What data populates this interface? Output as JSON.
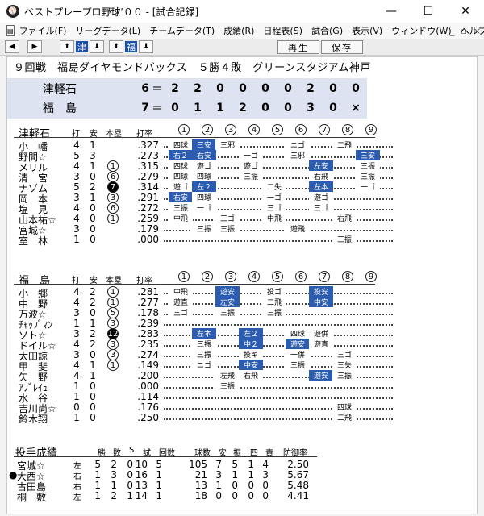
{
  "window": {
    "title": "ベストプレープロ野球'００ - [試合記録]",
    "minimize": "—",
    "maximize": "☐",
    "close": "✕"
  },
  "menu": [
    "ファイル(F)",
    "リーグデータ(L)",
    "チームデータ(T)",
    "成績(R)",
    "日程表(S)",
    "試合(G)",
    "表示(V)",
    "ウィンドウ(W)",
    "ヘルプ(H)"
  ],
  "mdi": {
    "minimize": "_",
    "restore": "▫",
    "close": "×"
  },
  "toolbar": {
    "prev": "◀",
    "next": "▶",
    "team1_up": "⬆",
    "team1_label": "津",
    "team1_down": "⬇",
    "team2_up": "⬆",
    "team2_label": "福",
    "team2_down": "⬇",
    "replay": "再生",
    "save": "保存"
  },
  "headline": "９回戦　福島ダイヤモンドバックス　５勝４敗　グリーンスタジアム神戸",
  "linescore": [
    {
      "team": "津軽石",
      "total": "6",
      "eq": "＝",
      "innings": [
        "2",
        "2",
        "0",
        "0",
        "0",
        "0",
        "2",
        "0",
        "0"
      ]
    },
    {
      "team": "福　島",
      "total": "7",
      "eq": "＝",
      "innings": [
        "0",
        "1",
        "1",
        "2",
        "0",
        "0",
        "3",
        "0",
        "×"
      ]
    }
  ],
  "innings_header": [
    "1",
    "2",
    "3",
    "4",
    "5",
    "6",
    "7",
    "8",
    "9"
  ],
  "col_labels": {
    "ab": "打",
    "h": "安",
    "hr": "本塁",
    "avg": "打率"
  },
  "away": {
    "team": "津軽石",
    "batters": [
      {
        "name": "小　幡",
        "ab": "4",
        "h": "1",
        "hr": "",
        "avg": ".327",
        "results": [
          "四球",
          "三安",
          "三邪",
          "",
          "",
          "ニゴ",
          "",
          "二飛",
          ""
        ]
      },
      {
        "name": "野間☆",
        "ab": "5",
        "h": "3",
        "hr": "",
        "avg": ".273",
        "results": [
          "右２",
          "右安",
          "",
          "一ゴ",
          "",
          "三邪",
          "",
          "",
          "三安"
        ]
      },
      {
        "name": "メリル",
        "ab": "4",
        "h": "1",
        "hr": "1",
        "avg": ".315",
        "results": [
          "四球",
          "遊ゴ",
          "",
          "遊ゴ",
          "",
          "",
          "左安",
          "",
          "三振"
        ]
      },
      {
        "name": "清　宮",
        "ab": "3",
        "h": "0",
        "hr": "6",
        "avg": ".279",
        "results": [
          "四球",
          "四球",
          "",
          "三振",
          "",
          "",
          "右飛",
          "",
          "三振"
        ]
      },
      {
        "name": "ナゾム",
        "ab": "5",
        "h": "2",
        "hr": "7",
        "avg": ".314",
        "results": [
          "遊ゴ",
          "左２",
          "",
          "",
          "二失",
          "",
          "左本",
          "",
          "一ゴ"
        ]
      },
      {
        "name": "岡　本",
        "ab": "3",
        "h": "1",
        "hr": "3",
        "avg": ".291",
        "results": [
          "右安",
          "四球",
          "",
          "",
          "一ゴ",
          "",
          "遊ゴ",
          "",
          ""
        ]
      },
      {
        "name": "塩　見",
        "ab": "4",
        "h": "0",
        "hr": "6",
        "avg": ".272",
        "results": [
          "三振",
          "一ゴ",
          "",
          "",
          "三ゴ",
          "",
          "三ゴ",
          "",
          ""
        ]
      },
      {
        "name": "山本祐☆",
        "ab": "4",
        "h": "0",
        "hr": "1",
        "avg": ".259",
        "results": [
          "中飛",
          "",
          "三ゴ",
          "",
          "中飛",
          "",
          "",
          "右飛",
          ""
        ]
      },
      {
        "name": "宮城☆",
        "ab": "3",
        "h": "0",
        "hr": "",
        "avg": ".179",
        "results": [
          "",
          "三振",
          "三振",
          "",
          "",
          "遊飛",
          "",
          "",
          ""
        ]
      },
      {
        "name": "室　林",
        "ab": "1",
        "h": "0",
        "hr": "",
        "avg": ".000",
        "results": [
          "",
          "",
          "",
          "",
          "",
          "",
          "",
          "三振",
          ""
        ]
      }
    ]
  },
  "home": {
    "team": "福　島",
    "batters": [
      {
        "name": "小　郷",
        "ab": "4",
        "h": "2",
        "hr": "1",
        "avg": ".281",
        "results": [
          "中飛",
          "",
          "遊安",
          "",
          "投ゴ",
          "",
          "投安",
          "",
          ""
        ]
      },
      {
        "name": "中　野",
        "ab": "4",
        "h": "2",
        "hr": "1",
        "avg": ".277",
        "results": [
          "遊直",
          "",
          "左安",
          "",
          "二飛",
          "",
          "中安",
          "",
          ""
        ]
      },
      {
        "name": "万波☆",
        "ab": "3",
        "h": "0",
        "hr": "5",
        "avg": ".178",
        "results": [
          "三ゴ",
          "",
          "三振",
          "",
          "三振",
          "",
          "",
          "",
          ""
        ]
      },
      {
        "name": "ﾁｬｯﾌﾟﾏﾝ",
        "ab": "1",
        "h": "1",
        "hr": "3",
        "avg": ".239",
        "results": [
          "",
          "",
          "",
          "",
          "",
          "",
          "",
          "",
          ""
        ]
      },
      {
        "name": "ソト☆",
        "ab": "3",
        "h": "2",
        "hr": "12",
        "avg": ".283",
        "results": [
          "",
          "左本",
          "",
          "左２",
          "",
          "四球",
          "遊併",
          "",
          ""
        ]
      },
      {
        "name": "ドイル☆",
        "ab": "4",
        "h": "2",
        "hr": "3",
        "avg": ".235",
        "results": [
          "",
          "三振",
          "",
          "中２",
          "",
          "遊安",
          "遊直",
          "",
          ""
        ]
      },
      {
        "name": "太田諒",
        "ab": "3",
        "h": "0",
        "hr": "3",
        "avg": ".274",
        "results": [
          "",
          "三振",
          "",
          "投ギ",
          "",
          "一併",
          "",
          "三ゴ",
          ""
        ]
      },
      {
        "name": "甲　斐",
        "ab": "4",
        "h": "1",
        "hr": "1",
        "avg": ".149",
        "results": [
          "",
          "ニゴ",
          "",
          "中安",
          "",
          "三振",
          "",
          "三失",
          ""
        ]
      },
      {
        "name": "矢　野",
        "ab": "4",
        "h": "1",
        "hr": "",
        "avg": ".200",
        "results": [
          "",
          "",
          "左飛",
          "右飛",
          "",
          "",
          "遊安",
          "三振",
          ""
        ]
      },
      {
        "name": "ｱﾌﾞﾚｲｭ",
        "ab": "1",
        "h": "0",
        "hr": "",
        "avg": ".000",
        "results": [
          "",
          "",
          "三振",
          "",
          "",
          "",
          "",
          "",
          ""
        ]
      },
      {
        "name": "水　谷",
        "ab": "1",
        "h": "0",
        "hr": "",
        "avg": ".114",
        "results": [
          "",
          "",
          "",
          "",
          "",
          "",
          "",
          "",
          ""
        ]
      },
      {
        "name": "吉川尚☆",
        "ab": "0",
        "h": "0",
        "hr": "",
        "avg": ".176",
        "results": [
          "",
          "",
          "",
          "",
          "",
          "",
          "",
          "四球",
          ""
        ]
      },
      {
        "name": "鈴木翔",
        "ab": "1",
        "h": "0",
        "hr": "",
        "avg": ".250",
        "results": [
          "",
          "",
          "",
          "",
          "",
          "",
          "",
          "二飛",
          ""
        ]
      }
    ]
  },
  "pitching": {
    "title": "投手成績",
    "headers": [
      "勝",
      "敗",
      "S",
      "試",
      "回数",
      "球数",
      "安",
      "振",
      "四",
      "責",
      "防御率"
    ],
    "pitchers": [
      {
        "mark": "",
        "name": "宮城☆",
        "hand": "左",
        "w": "5",
        "l": "2",
        "s": "0",
        "g": "10",
        "ip": "5",
        "np": "105",
        "h": "7",
        "k": "5",
        "bb": "1",
        "er": "4",
        "era": "2.50"
      },
      {
        "mark": "●",
        "name": "大西☆",
        "hand": "右",
        "w": "1",
        "l": "3",
        "s": "0",
        "g": "16",
        "ip": "1",
        "np": "21",
        "h": "3",
        "k": "1",
        "bb": "1",
        "er": "3",
        "era": "5.67"
      },
      {
        "mark": "",
        "name": "古田島",
        "hand": "右",
        "w": "1",
        "l": "1",
        "s": "0",
        "g": "13",
        "ip": "1",
        "np": "13",
        "h": "1",
        "k": "0",
        "bb": "0",
        "er": "0",
        "era": "5.48"
      },
      {
        "mark": "",
        "name": "桐　敷",
        "hand": "左",
        "w": "1",
        "l": "2",
        "s": "1",
        "g": "14",
        "ip": "1",
        "np": "18",
        "h": "0",
        "k": "0",
        "bb": "0",
        "er": "0",
        "era": "4.41"
      }
    ]
  }
}
